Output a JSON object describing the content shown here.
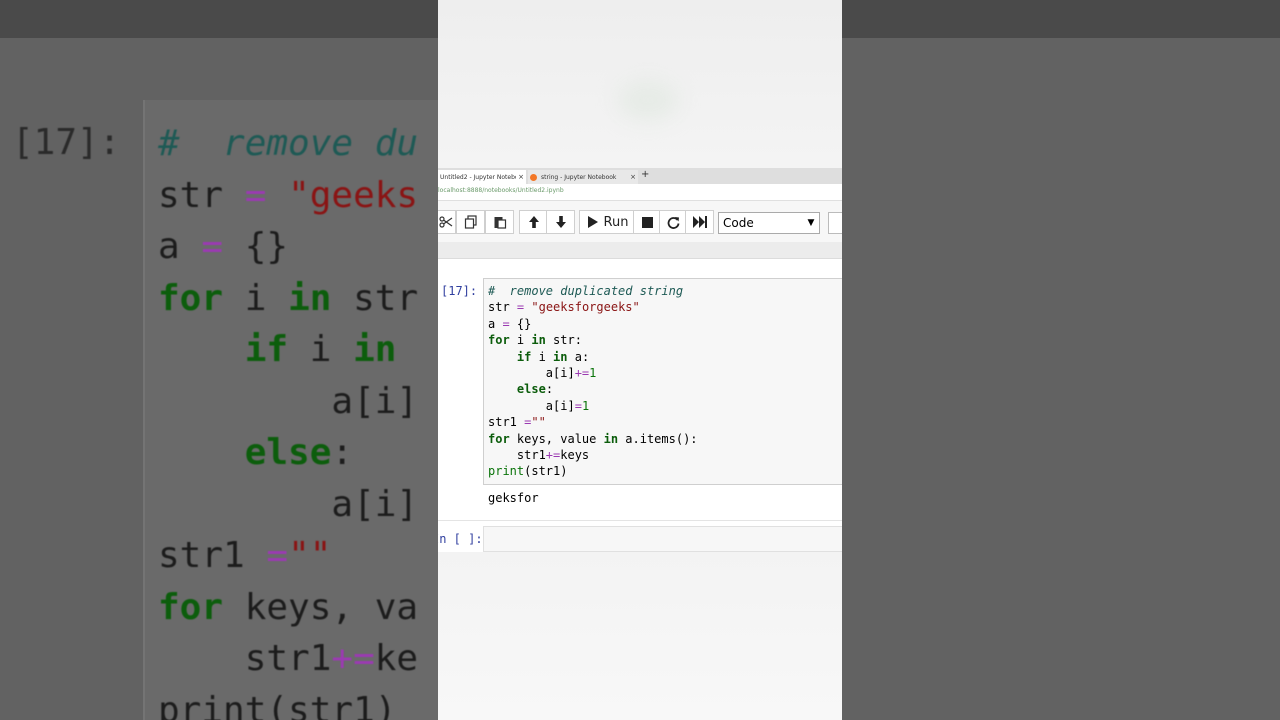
{
  "tabs": [
    {
      "label": "Untitled2 - Jupyter Notebook",
      "close": "×"
    },
    {
      "label": "string - Jupyter Notebook",
      "close": "×"
    }
  ],
  "new_tab": "+",
  "url": "localhost:8888/notebooks/Untitled2.ipynb",
  "toolbar": {
    "run_label": "Run",
    "cell_type": "Code"
  },
  "cells": [
    {
      "prompt": "[17]:",
      "output": "geksfor"
    },
    {
      "prompt": "In [ ]:"
    }
  ],
  "code_lines": [
    "#  remove duplicated string",
    "str = \"geeksforgeeks\"",
    "a = {}",
    "for i in str:",
    "    if i in a:",
    "        a[i]+=1",
    "    else:",
    "        a[i]=1",
    "str1 =\"\"",
    "for keys, value in a.items():",
    "    str1+=keys",
    "print(str1)"
  ],
  "colors": {
    "keyword": "#008000",
    "comment": "#408080",
    "string": "#ba2121",
    "operator": "#aa22ff",
    "number": "#008000",
    "prompt": "#303f9f"
  }
}
